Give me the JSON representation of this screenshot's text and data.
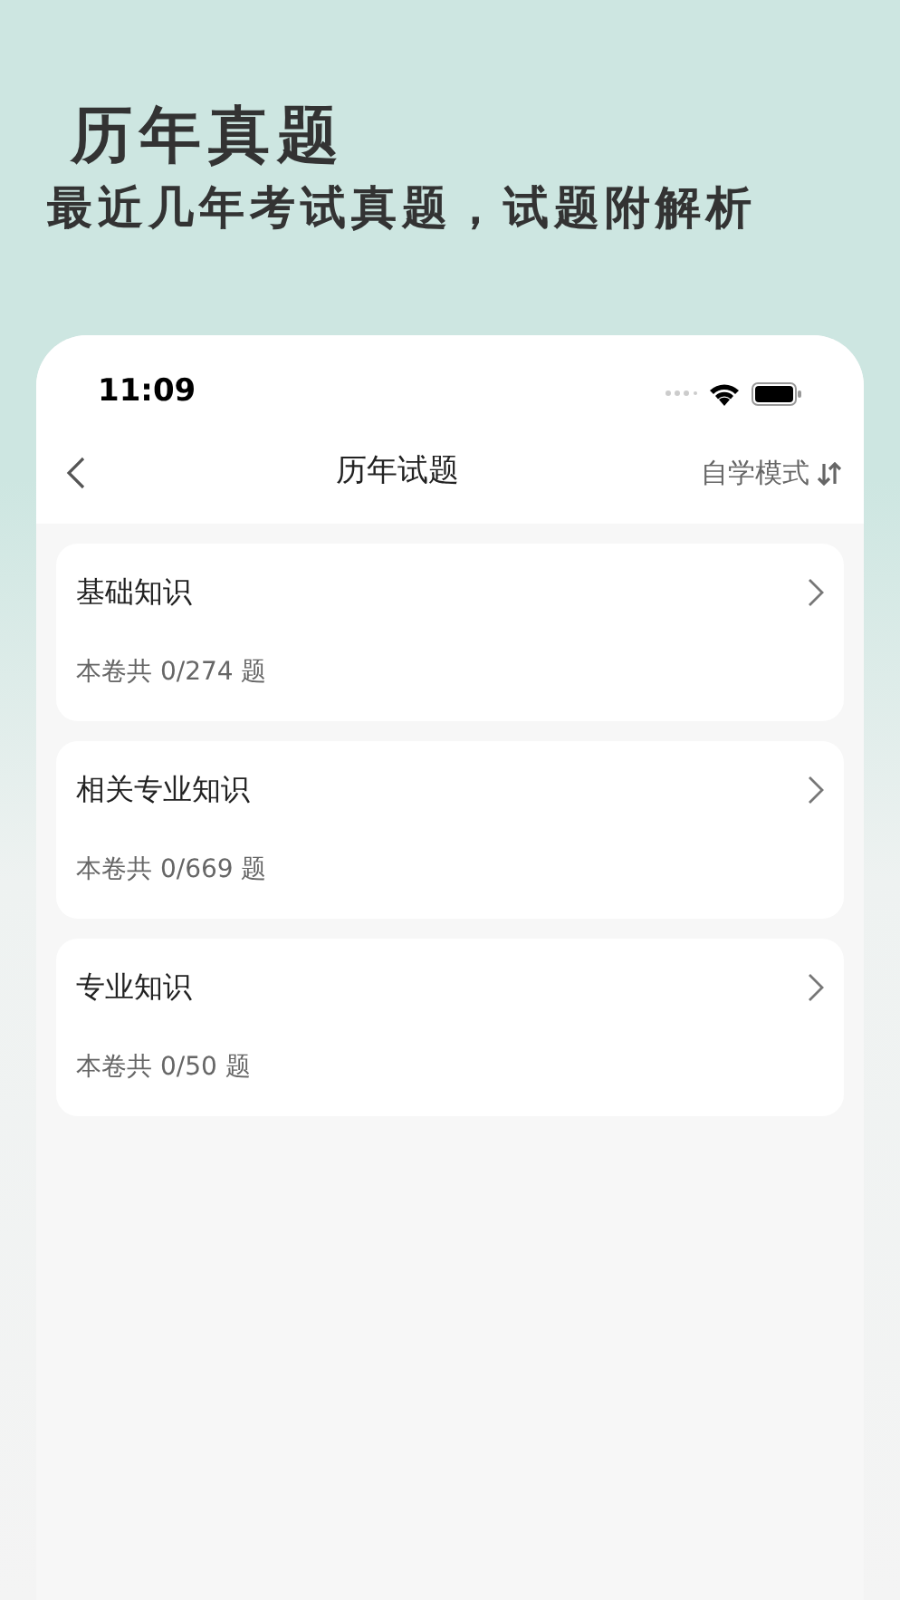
{
  "headline": {
    "title": "历年真题",
    "subtitle": "最近几年考试真题，试题附解析"
  },
  "status_bar": {
    "time": "11:09"
  },
  "nav": {
    "title": "历年试题",
    "mode": "自学模式"
  },
  "papers": [
    {
      "title": "基础知识",
      "count": "本卷共 0/274 题"
    },
    {
      "title": "相关专业知识",
      "count": "本卷共 0/669 题"
    },
    {
      "title": "专业知识",
      "count": "本卷共 0/50 题"
    }
  ]
}
